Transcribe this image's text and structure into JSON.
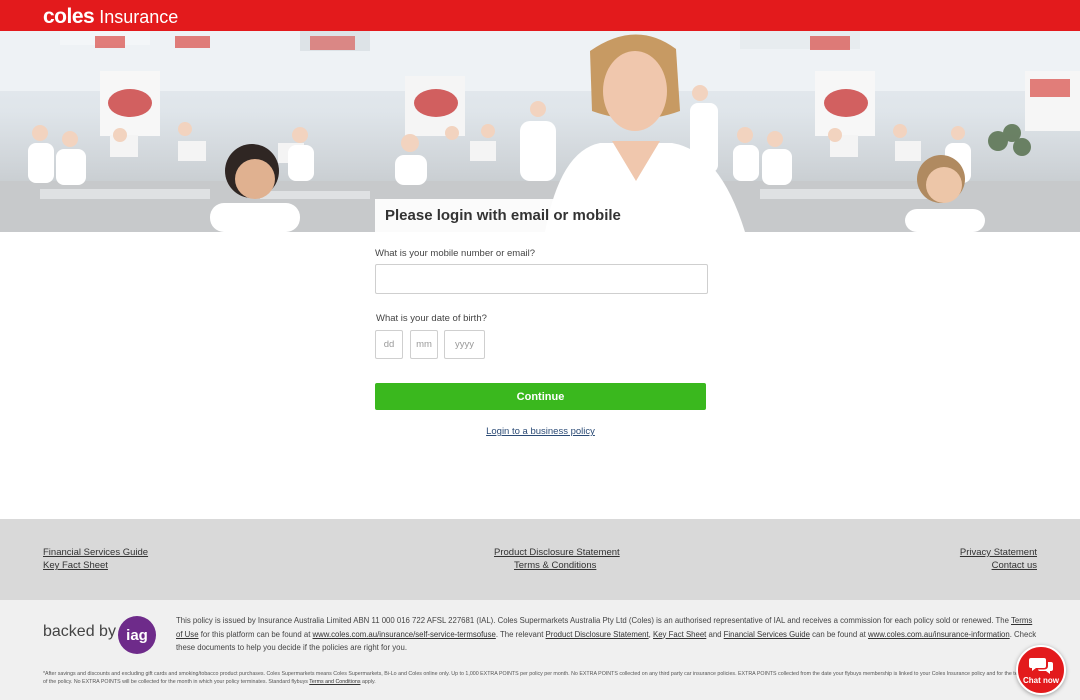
{
  "header": {
    "brand_primary": "coles",
    "brand_secondary": "Insurance"
  },
  "hero": {
    "heading": "Please login with email or mobile"
  },
  "form": {
    "mobile_label": "What is your mobile number or email?",
    "mobile_value": "",
    "dob_label": "What is your date of birth?",
    "dob_day_placeholder": "dd",
    "dob_month_placeholder": "mm",
    "dob_year_placeholder": "yyyy",
    "continue_label": "Continue",
    "business_link": "Login to a business policy"
  },
  "footer_links": {
    "financial_services_guide": "Financial Services Guide",
    "key_fact_sheet": "Key Fact Sheet",
    "product_disclosure_statement": "Product Disclosure Statement",
    "terms_conditions": "Terms & Conditions",
    "privacy_statement": "Privacy Statement",
    "contact_us": "Contact us"
  },
  "legal": {
    "backed_by": "backed by",
    "iag_logo_text": "iag",
    "p1": "This policy is issued by Insurance Australia Limited ABN 11 000 016 722 AFSL 227681 (IAL). Coles Supermarkets Australia Pty Ltd (Coles) is an authorised representative of IAL and receives a commission for each policy sold or renewed. The ",
    "terms_of_use": "Terms of Use",
    "p2": " for this platform can be found at ",
    "url_terms": "www.coles.com.au/insurance/self-service-termsofuse",
    "p3": ". The relevant ",
    "pds": "Product Disclosure Statement",
    "p4": ", ",
    "kfs": "Key Fact Sheet",
    "p5": " and ",
    "fsg": "Financial Services Guide",
    "p6": " can be found at ",
    "url_info": "www.coles.com.au/insurance-information",
    "p7": ". Check these documents to help you decide if the policies are right for you.",
    "small_print": "*After savings and discounts and excluding gift cards and smoking/tobacco product purchases. Coles Supermarkets means Coles Supermarkets, Bi-Lo and Coles online only. Up to 1,000 EXTRA POINTS per policy per month. No EXTRA POINTS collected on any third party car insurance policies. EXTRA POINTS collected from the date your flybuys membership is linked to your Coles Insurance policy and for the term of the policy. No EXTRA POINTS will be collected for the month in which your policy terminates. Standard flybuys ",
    "small_terms": "Terms and Conditions",
    "small_end": " apply."
  },
  "chat": {
    "label": "Chat now",
    "icon": "chat-bubbles-icon"
  },
  "colors": {
    "brand_red": "#e31a1c",
    "continue_green": "#3ab81e",
    "iag_purple": "#6e2b8a"
  }
}
